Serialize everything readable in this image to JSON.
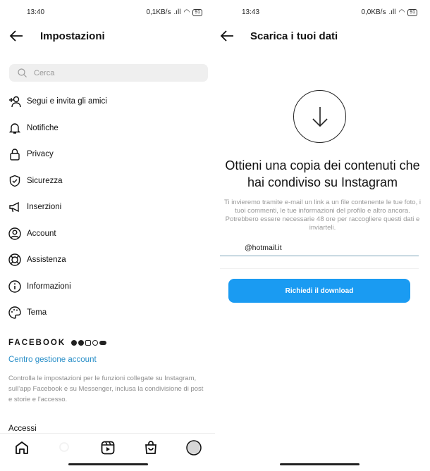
{
  "left": {
    "status": {
      "time": "13:40",
      "speed": "0,1KB/s",
      "battery": "91"
    },
    "title": "Impostazioni",
    "search_placeholder": "Cerca",
    "items": [
      {
        "label": "Segui e invita gli amici",
        "icon": "add-person-icon"
      },
      {
        "label": "Notifiche",
        "icon": "bell-icon"
      },
      {
        "label": "Privacy",
        "icon": "lock-icon"
      },
      {
        "label": "Sicurezza",
        "icon": "shield-icon"
      },
      {
        "label": "Inserzioni",
        "icon": "megaphone-icon"
      },
      {
        "label": "Account",
        "icon": "account-icon"
      },
      {
        "label": "Assistenza",
        "icon": "lifebuoy-icon"
      },
      {
        "label": "Informazioni",
        "icon": "info-icon"
      },
      {
        "label": "Tema",
        "icon": "palette-icon"
      }
    ],
    "facebook_label": "FACEBOOK",
    "account_center_link": "Centro gestione account",
    "account_center_desc": "Controlla le impostazioni per le funzioni collegate su Instagram, sull'app Facebook e su Messenger, inclusa la condivisione di post e storie e l'accesso.",
    "accessi": "Accessi"
  },
  "right": {
    "status": {
      "time": "13:43",
      "speed": "0,0KB/s",
      "battery": "91"
    },
    "title": "Scarica i tuoi dati",
    "heading": "Ottieni una copia dei contenuti che hai condiviso su Instagram",
    "description": "Ti invieremo tramite e-mail un link a un file contenente le tue foto, i tuoi commenti, le tue informazioni del profilo e altro ancora. Potrebbero essere necessarie 48 ore per raccogliere questi dati e inviarteli.",
    "email_value": "@hotmail.it",
    "button": "Richiedi il download"
  },
  "colors": {
    "accent": "#1a9bf2",
    "link": "#2a8fc8"
  }
}
